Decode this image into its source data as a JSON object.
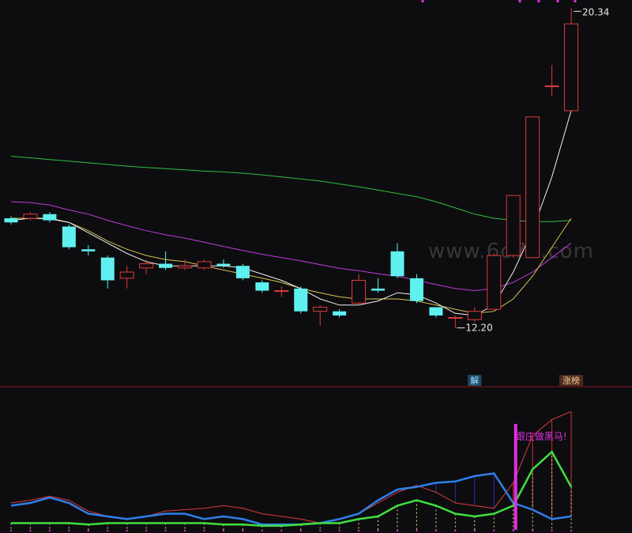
{
  "chart_data": {
    "type": "candlestick",
    "price_panel": {
      "ylim": [
        11.4,
        20.5
      ],
      "candles": [
        {
          "o": 15.2,
          "c": 15.3,
          "h": 15.35,
          "l": 15.15,
          "up": false
        },
        {
          "o": 15.3,
          "c": 15.4,
          "h": 15.45,
          "l": 15.25,
          "up": true
        },
        {
          "o": 15.4,
          "c": 15.25,
          "h": 15.45,
          "l": 15.2,
          "up": false
        },
        {
          "o": 15.1,
          "c": 14.6,
          "h": 15.15,
          "l": 14.55,
          "up": false
        },
        {
          "o": 14.55,
          "c": 14.5,
          "h": 14.65,
          "l": 14.4,
          "up": false
        },
        {
          "o": 14.35,
          "c": 13.8,
          "h": 14.4,
          "l": 13.6,
          "up": false
        },
        {
          "o": 13.85,
          "c": 14.0,
          "h": 14.15,
          "l": 13.6,
          "up": true
        },
        {
          "o": 14.1,
          "c": 14.2,
          "h": 14.3,
          "l": 13.95,
          "up": true
        },
        {
          "o": 14.2,
          "c": 14.1,
          "h": 14.5,
          "l": 14.05,
          "up": false
        },
        {
          "o": 14.1,
          "c": 14.15,
          "h": 14.3,
          "l": 14.05,
          "up": true
        },
        {
          "o": 14.1,
          "c": 14.25,
          "h": 14.3,
          "l": 14.05,
          "up": true
        },
        {
          "o": 14.2,
          "c": 14.15,
          "h": 14.3,
          "l": 14.1,
          "up": false
        },
        {
          "o": 14.15,
          "c": 13.85,
          "h": 14.2,
          "l": 13.8,
          "up": false
        },
        {
          "o": 13.75,
          "c": 13.55,
          "h": 13.8,
          "l": 13.5,
          "up": false
        },
        {
          "o": 13.55,
          "c": 13.55,
          "h": 13.65,
          "l": 13.4,
          "up": true
        },
        {
          "o": 13.6,
          "c": 13.05,
          "h": 13.65,
          "l": 13.0,
          "up": false
        },
        {
          "o": 13.05,
          "c": 13.15,
          "h": 13.2,
          "l": 12.7,
          "up": true
        },
        {
          "o": 13.05,
          "c": 12.95,
          "h": 13.1,
          "l": 12.9,
          "up": false
        },
        {
          "o": 13.25,
          "c": 13.8,
          "h": 13.95,
          "l": 13.2,
          "up": true
        },
        {
          "o": 13.6,
          "c": 13.55,
          "h": 13.85,
          "l": 13.5,
          "up": false
        },
        {
          "o": 13.9,
          "c": 14.5,
          "h": 14.7,
          "l": 13.85,
          "up": false
        },
        {
          "o": 13.85,
          "c": 13.3,
          "h": 13.95,
          "l": 13.25,
          "up": false
        },
        {
          "o": 13.15,
          "c": 12.95,
          "h": 13.15,
          "l": 12.9,
          "up": false
        },
        {
          "o": 12.9,
          "c": 12.9,
          "h": 12.95,
          "l": 12.65,
          "up": true
        },
        {
          "o": 12.85,
          "c": 13.05,
          "h": 13.15,
          "l": 12.8,
          "up": true
        },
        {
          "o": 13.1,
          "c": 14.4,
          "h": 14.45,
          "l": 13.1,
          "up": true
        },
        {
          "o": 14.4,
          "c": 15.85,
          "h": 15.85,
          "l": 14.35,
          "up": true
        },
        {
          "o": 14.35,
          "c": 17.75,
          "h": 17.75,
          "l": 14.4,
          "up": true
        },
        {
          "o": 18.5,
          "c": 18.5,
          "h": 19.0,
          "l": 18.25,
          "up": true
        },
        {
          "o": 17.9,
          "c": 20.0,
          "h": 20.38,
          "l": 17.9,
          "up": true
        }
      ],
      "ma_white": [
        15.25,
        15.3,
        15.3,
        15.2,
        14.95,
        14.7,
        14.45,
        14.25,
        14.15,
        14.15,
        14.15,
        14.15,
        14.1,
        13.95,
        13.8,
        13.6,
        13.35,
        13.2,
        13.2,
        13.3,
        13.5,
        13.45,
        13.25,
        13.0,
        12.95,
        13.2,
        14.0,
        15.0,
        16.3,
        17.9
      ],
      "ma_yellow": [
        15.3,
        15.3,
        15.28,
        15.2,
        15.0,
        14.75,
        14.55,
        14.4,
        14.3,
        14.25,
        14.15,
        14.05,
        13.95,
        13.85,
        13.75,
        13.6,
        13.5,
        13.4,
        13.35,
        13.35,
        13.35,
        13.3,
        13.2,
        13.1,
        13.0,
        13.05,
        13.35,
        13.9,
        14.6,
        15.3
      ],
      "ma_purple": [
        15.7,
        15.68,
        15.62,
        15.5,
        15.4,
        15.25,
        15.12,
        15.0,
        14.9,
        14.82,
        14.72,
        14.62,
        14.52,
        14.43,
        14.35,
        14.27,
        14.18,
        14.09,
        14.03,
        13.96,
        13.9,
        13.8,
        13.7,
        13.6,
        13.55,
        13.6,
        13.75,
        14.0,
        14.35,
        14.7
      ],
      "ma_green": [
        16.8,
        16.76,
        16.72,
        16.68,
        16.64,
        16.6,
        16.56,
        16.53,
        16.5,
        16.47,
        16.44,
        16.42,
        16.39,
        16.35,
        16.3,
        16.25,
        16.2,
        16.13,
        16.06,
        15.98,
        15.9,
        15.82,
        15.7,
        15.55,
        15.4,
        15.3,
        15.25,
        15.22,
        15.22,
        15.25
      ],
      "high_label": "20.34",
      "low_label": "12.20",
      "flag_labels": [
        {
          "index": 24,
          "text": "解"
        },
        {
          "index": 29,
          "text": "涨榜"
        }
      ],
      "watermark": "www.6o7o.com"
    },
    "indicator_panel": {
      "ylim": [
        0,
        100
      ],
      "red": [
        20,
        22,
        25,
        22,
        14,
        10,
        8,
        10,
        14,
        15,
        16,
        18,
        16,
        12,
        10,
        8,
        5,
        8,
        12,
        20,
        28,
        33,
        28,
        20,
        18,
        16,
        35,
        70,
        82,
        88
      ],
      "blue": [
        18,
        20,
        24,
        20,
        12,
        10,
        8,
        10,
        12,
        12,
        8,
        10,
        8,
        4,
        4,
        4,
        5,
        8,
        12,
        22,
        30,
        32,
        35,
        36,
        40,
        42,
        20,
        15,
        8,
        10
      ],
      "green": [
        5,
        5,
        5,
        5,
        4,
        5,
        5,
        5,
        5,
        5,
        5,
        4,
        4,
        3,
        3,
        4,
        5,
        5,
        8,
        10,
        18,
        22,
        18,
        12,
        10,
        12,
        18,
        45,
        58,
        32
      ],
      "marker_index": 26,
      "marker_text": "跟庄做黑马!"
    }
  }
}
